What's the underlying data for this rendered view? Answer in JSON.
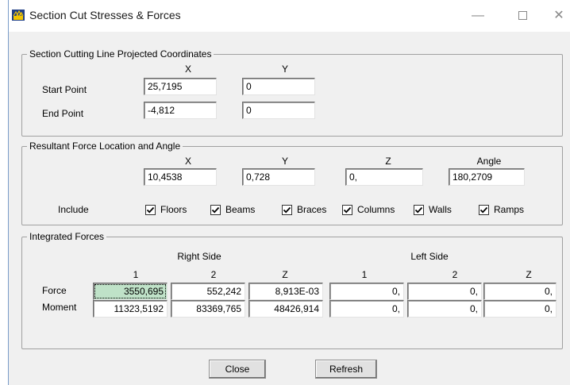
{
  "window": {
    "title": "Section Cut Stresses & Forces",
    "minimize_glyph": "—",
    "close_glyph": "✕"
  },
  "section_line": {
    "legend": "Section Cutting Line Projected Coordinates",
    "col_x": "X",
    "col_y": "Y",
    "start_label": "Start Point",
    "end_label": "End Point",
    "start_x": "25,7195",
    "start_y": "0",
    "end_x": "-4,812",
    "end_y": "0"
  },
  "resultant": {
    "legend": "Resultant Force Location and Angle",
    "col_x": "X",
    "col_y": "Y",
    "col_z": "Z",
    "col_angle": "Angle",
    "x": "10,4538",
    "y": "0,728",
    "z": "0,",
    "angle": "180,2709",
    "include_label": "Include",
    "includes": [
      {
        "label": "Floors",
        "checked": true
      },
      {
        "label": "Beams",
        "checked": true
      },
      {
        "label": "Braces",
        "checked": true
      },
      {
        "label": "Columns",
        "checked": true
      },
      {
        "label": "Walls",
        "checked": true
      },
      {
        "label": "Ramps",
        "checked": true
      }
    ]
  },
  "integrated": {
    "legend": "Integrated Forces",
    "right_side": "Right Side",
    "left_side": "Left Side",
    "cols": [
      "1",
      "2",
      "Z"
    ],
    "force_label": "Force",
    "moment_label": "Moment",
    "right_force": [
      "3550,695",
      "552,242",
      "8,913E-03"
    ],
    "right_moment": [
      "11323,5192",
      "83369,765",
      "48426,914"
    ],
    "left_force": [
      "0,",
      "0,",
      "0,"
    ],
    "left_moment": [
      "0,",
      "0,",
      "0,"
    ]
  },
  "buttons": {
    "close": "Close",
    "refresh": "Refresh"
  }
}
